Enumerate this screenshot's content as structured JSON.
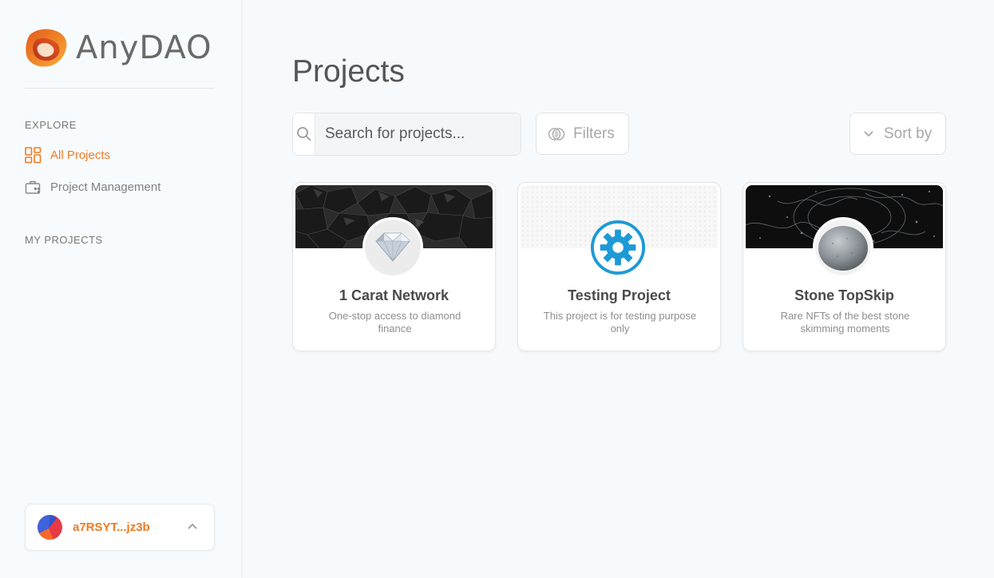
{
  "brand": {
    "name": "AnyDAO"
  },
  "sidebar": {
    "explore_label": "EXPLORE",
    "nav": [
      {
        "label": "All Projects",
        "icon": "grid-icon",
        "active": true
      },
      {
        "label": "Project Management",
        "icon": "briefcase-icon",
        "active": false
      }
    ],
    "my_projects_label": "MY PROJECTS",
    "wallet": {
      "address": "a7RSYT...jz3b"
    }
  },
  "main": {
    "title": "Projects",
    "search": {
      "placeholder": "Search for projects..."
    },
    "filters_label": "Filters",
    "sort_label": "Sort by",
    "projects": [
      {
        "title": "1 Carat Network",
        "description": "One-stop access to diamond finance"
      },
      {
        "title": "Testing Project",
        "description": "This project is for testing purpose only"
      },
      {
        "title": "Stone TopSkip",
        "description": "Rare NFTs of the best stone skimming moments"
      }
    ]
  },
  "colors": {
    "accent": "#f07a22",
    "gear": "#1d9ad6"
  }
}
